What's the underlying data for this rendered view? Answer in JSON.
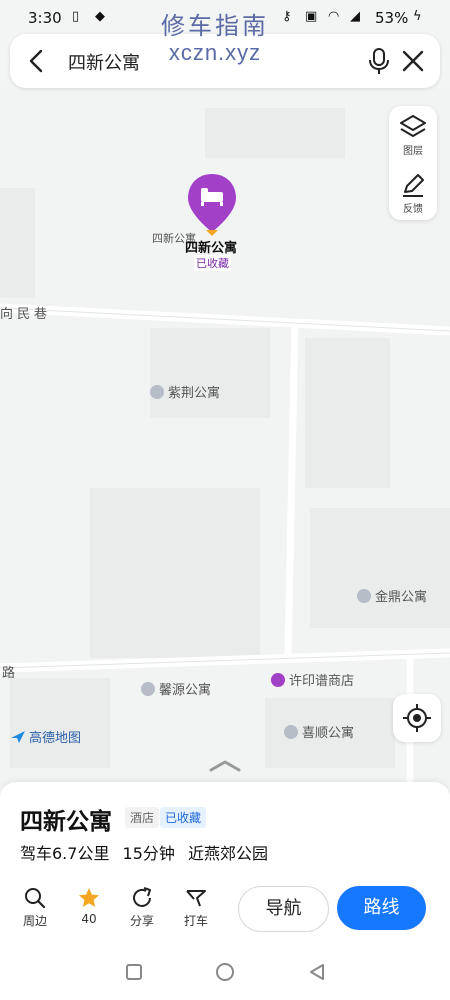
{
  "status_bar": {
    "time": "3:30",
    "battery": "53%"
  },
  "watermark": {
    "line1": "修车指南",
    "line2": "xczn.xyz"
  },
  "search": {
    "query": "四新公寓"
  },
  "map": {
    "road_labels": [
      "向民巷",
      "路"
    ],
    "pois": [
      "紫荆公寓",
      "金鼎公寓",
      "馨源公寓",
      "许印谱商店",
      "喜顺公寓"
    ],
    "marker": {
      "name": "四新公寓",
      "name_small": "四新公寓",
      "badge": "已收藏"
    },
    "tools": {
      "layers_label": "图层",
      "feedback_label": "反馈"
    },
    "logo": "高德地图"
  },
  "place": {
    "title": "四新公寓",
    "category": "酒店",
    "fav_badge": "已收藏",
    "drive": "驾车6.7公里",
    "duration": "15分钟",
    "nearby": "近燕郊公园"
  },
  "actions": {
    "nearby_label": "周边",
    "star_count": "40",
    "share_label": "分享",
    "taxi_label": "打车",
    "nav_label": "导航",
    "route_label": "路线"
  },
  "colors": {
    "accent": "#1677ff",
    "marker": "#a340c8",
    "star": "#f5a623"
  }
}
